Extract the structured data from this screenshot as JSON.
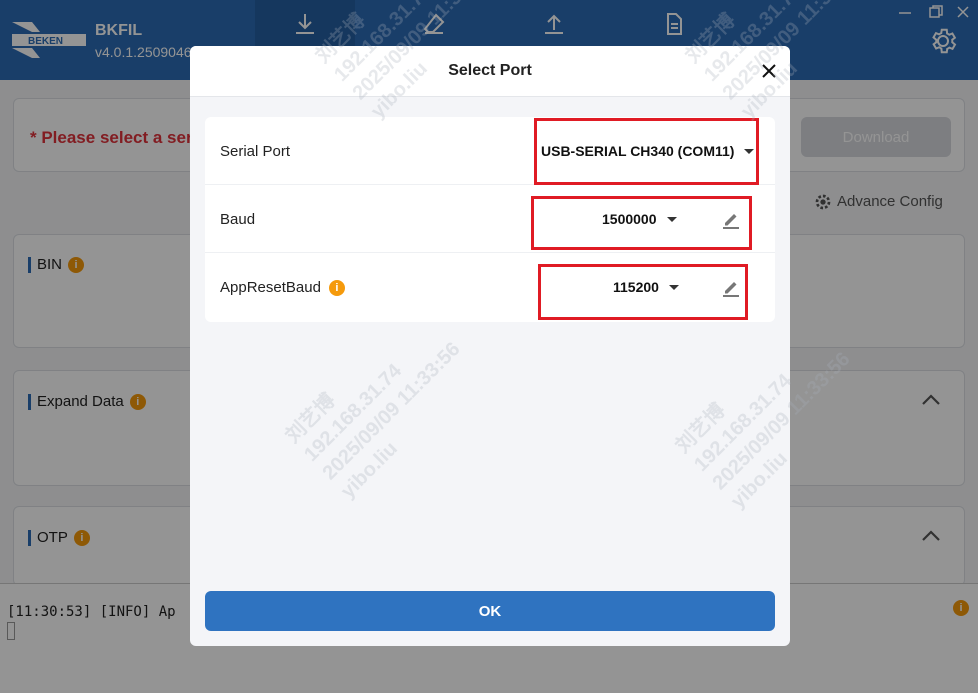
{
  "app": {
    "logo_text": "BEKEN",
    "title": "BKFIL",
    "version": "v4.0.1.2509046"
  },
  "main": {
    "warning": "* Please select a serial port",
    "download_label": "Download",
    "advance_label": "Advance Config",
    "sections": [
      {
        "label": "BIN"
      },
      {
        "label": "Expand Data"
      },
      {
        "label": "OTP"
      }
    ],
    "log_line": "[11:30:53] [INFO] Ap"
  },
  "dialog": {
    "title": "Select Port",
    "rows": [
      {
        "label": "Serial Port",
        "value": "USB-SERIAL CH340 (COM11)"
      },
      {
        "label": "Baud",
        "value": "1500000"
      },
      {
        "label": "AppResetBaud",
        "value": "115200"
      }
    ],
    "ok_label": "OK"
  },
  "watermark": {
    "line1": "刘艺博",
    "line2": "192.168.31.74",
    "line3": "2025/09/09 11:33:56",
    "line4": "yibo.liu"
  },
  "colors": {
    "header": "#2b6cb5",
    "primary_button": "#2f73c0",
    "warning_text": "#e0323c",
    "info_badge": "#f59a0c",
    "highlight_box": "#e01b24"
  },
  "icons": {
    "download": "download-icon",
    "erase": "eraser-icon",
    "upload": "upload-icon",
    "file": "file-icon",
    "settings": "gear-icon",
    "close": "close-icon",
    "edit": "pencil-icon",
    "info": "info-icon",
    "collapse": "chevron-up-icon"
  }
}
